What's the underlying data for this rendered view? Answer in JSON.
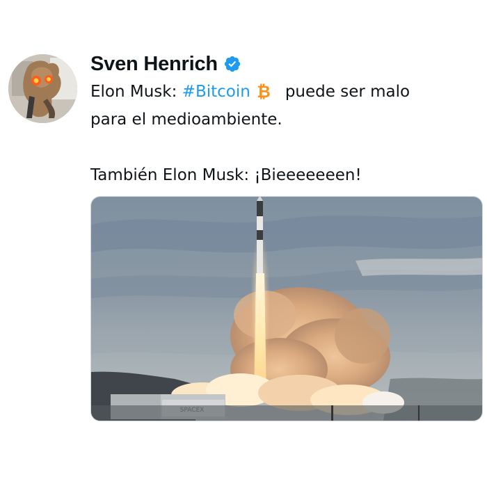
{
  "author": {
    "name": "Sven Henrich",
    "verified_icon": "verified-badge-icon",
    "avatar": "profile-avatar-photo"
  },
  "tweet": {
    "line1_prefix": "Elon Musk: ",
    "hashtag": "#Bitcoin",
    "bitcoin_icon": "bitcoin-icon",
    "line1_suffix": "puede ser malo",
    "line2": "para el medioambiente.",
    "line3": "También Elon Musk: ¡Bieeeeeeen!"
  },
  "media": {
    "image": "rocket-launch-photo"
  },
  "colors": {
    "hashtag": "#1d9bf0",
    "verified": "#1d9bf0",
    "bitcoin": "#f7931a",
    "text": "#0f1419"
  }
}
